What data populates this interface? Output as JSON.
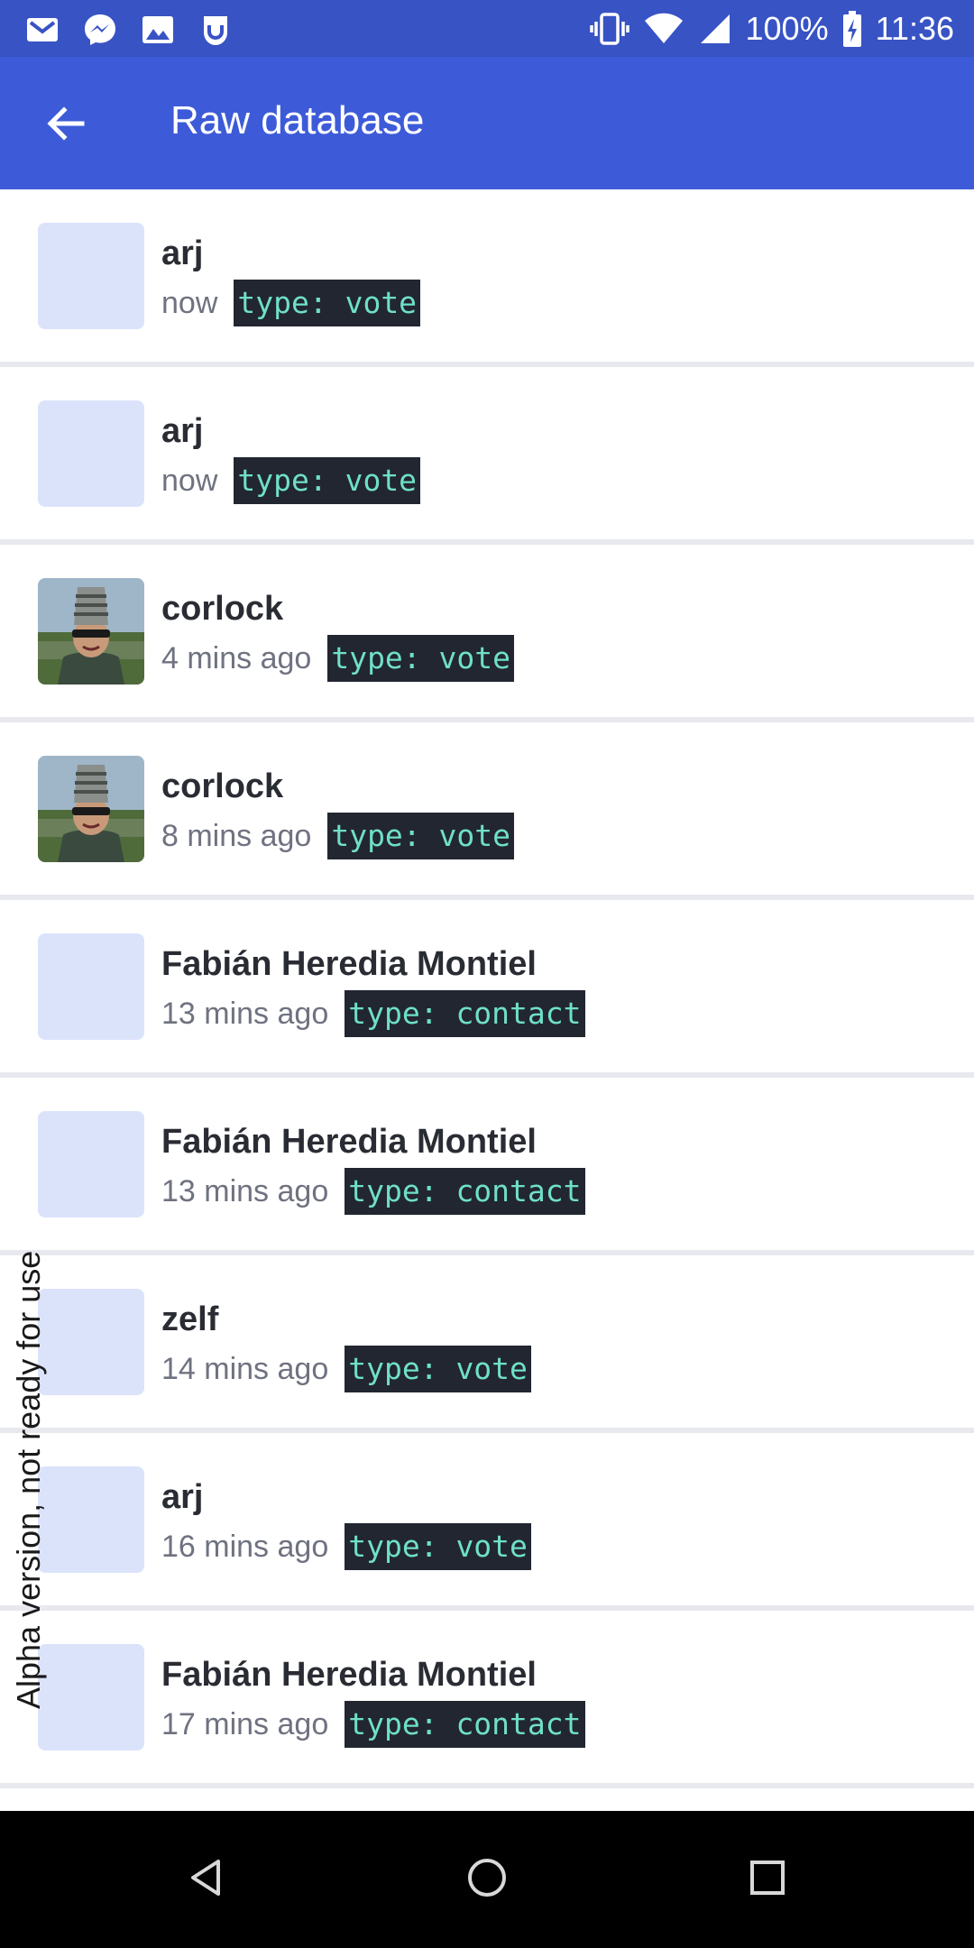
{
  "status_bar": {
    "notification_icons": [
      "gmail-icon",
      "messenger-icon",
      "image-icon",
      "app-icon"
    ],
    "battery_percent": "100%",
    "time": "11:36"
  },
  "app_bar": {
    "title": "Raw database",
    "back_icon": "arrow-left-icon"
  },
  "colors": {
    "status_bar": "#3853c4",
    "app_bar": "#3d5bd8",
    "avatar_placeholder": "#dbe3fb",
    "badge_bg": "#222631",
    "badge_text": "#6fe0c8"
  },
  "items": [
    {
      "author": "arj",
      "time": "now",
      "type": "type: vote",
      "avatar": "placeholder"
    },
    {
      "author": "arj",
      "time": "now",
      "type": "type: vote",
      "avatar": "placeholder"
    },
    {
      "author": "corlock",
      "time": "4 mins ago",
      "type": "type: vote",
      "avatar": "photo"
    },
    {
      "author": "corlock",
      "time": "8 mins ago",
      "type": "type: vote",
      "avatar": "photo"
    },
    {
      "author": "Fabián Heredia Montiel",
      "time": "13 mins ago",
      "type": "type: contact",
      "avatar": "placeholder"
    },
    {
      "author": "Fabián Heredia Montiel",
      "time": "13 mins ago",
      "type": "type: contact",
      "avatar": "placeholder"
    },
    {
      "author": "zelf",
      "time": "14 mins ago",
      "type": "type: vote",
      "avatar": "placeholder"
    },
    {
      "author": "arj",
      "time": "16 mins ago",
      "type": "type: vote",
      "avatar": "placeholder"
    },
    {
      "author": "Fabián Heredia Montiel",
      "time": "17 mins ago",
      "type": "type: contact",
      "avatar": "placeholder"
    }
  ],
  "watermark": "Alpha version, not ready for use",
  "nav_bar": {
    "buttons": [
      "back-triangle-icon",
      "home-circle-icon",
      "recents-square-icon"
    ]
  }
}
